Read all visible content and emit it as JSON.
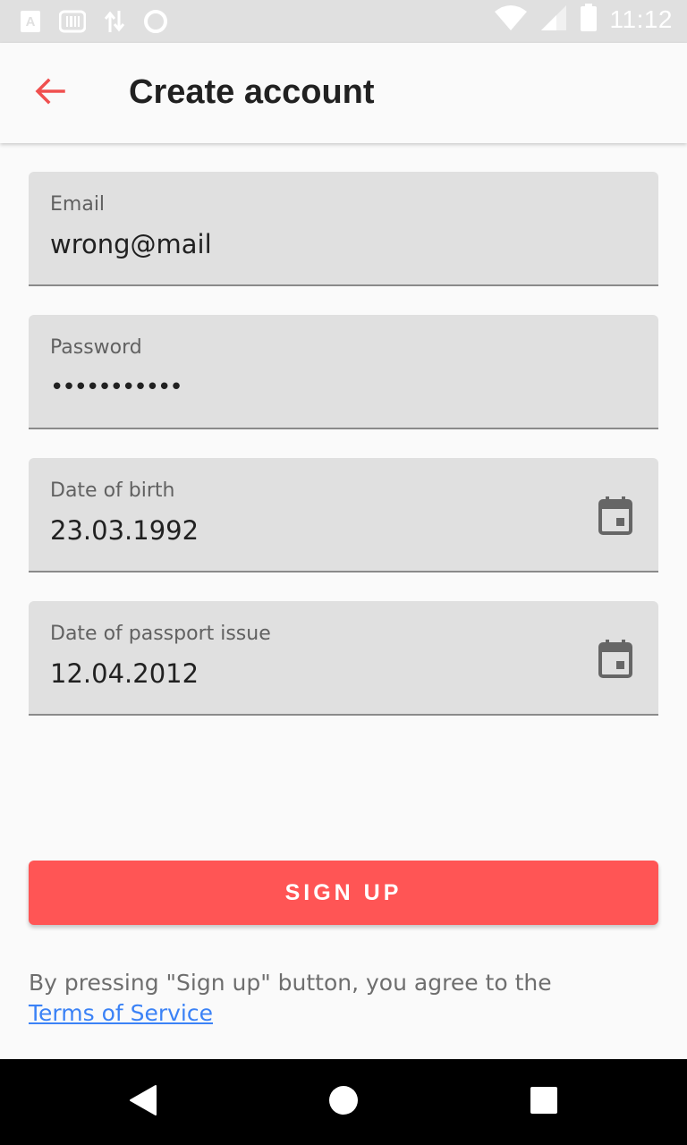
{
  "status_bar": {
    "time": "11:12",
    "icons": [
      "a-badge-icon",
      "barcode-icon",
      "data-transfer-icon",
      "circle-icon",
      "wifi-icon",
      "signal-icon",
      "battery-icon"
    ]
  },
  "app_bar": {
    "title": "Create account",
    "back_icon": "arrow-left-icon"
  },
  "form": {
    "email": {
      "label": "Email",
      "value": "wrong@mail"
    },
    "password": {
      "label": "Password",
      "value": "•••••••••••"
    },
    "date_of_birth": {
      "label": "Date of birth",
      "value": "23.03.1992",
      "icon": "calendar-icon"
    },
    "passport_issue": {
      "label": "Date of passport issue",
      "value": "12.04.2012",
      "icon": "calendar-icon"
    }
  },
  "signup_button": {
    "label": "SIGN UP"
  },
  "terms": {
    "prefix": "By pressing \"Sign up\" button, you agree to the ",
    "link": "Terms of Service"
  },
  "nav_bar": {
    "icons": [
      "back-triangle-icon",
      "home-circle-icon",
      "recents-square-icon"
    ]
  },
  "colors": {
    "accent": "#ff5555",
    "link": "#3b82f6",
    "field_bg": "#e0e0e0"
  }
}
